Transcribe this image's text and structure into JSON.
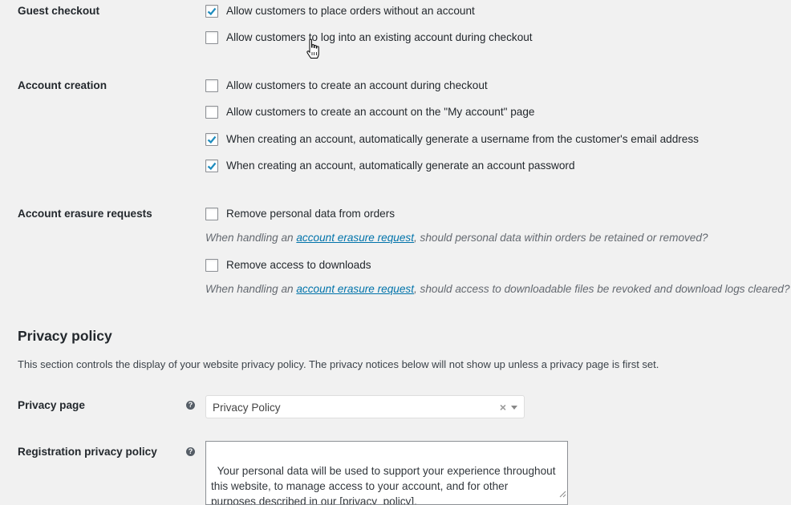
{
  "guest_checkout": {
    "label": "Guest checkout",
    "options": [
      {
        "label": "Allow customers to place orders without an account",
        "checked": true
      },
      {
        "label": "Allow customers to log into an existing account during checkout",
        "checked": false
      }
    ]
  },
  "account_creation": {
    "label": "Account creation",
    "options": [
      {
        "label": "Allow customers to create an account during checkout",
        "checked": false
      },
      {
        "label": "Allow customers to create an account on the \"My account\" page",
        "checked": false
      },
      {
        "label": "When creating an account, automatically generate a username from the customer's email address",
        "checked": true
      },
      {
        "label": "When creating an account, automatically generate an account password",
        "checked": true
      }
    ]
  },
  "account_erasure": {
    "label": "Account erasure requests",
    "options": [
      {
        "label": "Remove personal data from orders",
        "checked": false,
        "desc_prefix": "When handling an ",
        "desc_link": "account erasure request",
        "desc_suffix": ", should personal data within orders be retained or removed?"
      },
      {
        "label": "Remove access to downloads",
        "checked": false,
        "desc_prefix": "When handling an ",
        "desc_link": "account erasure request",
        "desc_suffix": ", should access to downloadable files be revoked and download logs cleared?"
      }
    ]
  },
  "privacy_policy": {
    "heading": "Privacy policy",
    "description": "This section controls the display of your website privacy policy. The privacy notices below will not show up unless a privacy page is first set.",
    "privacy_page": {
      "label": "Privacy page",
      "value": "Privacy Policy",
      "clear_glyph": "×"
    },
    "registration": {
      "label": "Registration privacy policy",
      "value": "Your personal data will be used to support your experience throughout\nthis website, to manage access to your account, and for other\npurposes described in our [privacy_policy]."
    },
    "help_glyph": "?"
  },
  "colors": {
    "background": "#f1f1f1",
    "link": "#0073aa",
    "text": "#23282d"
  }
}
